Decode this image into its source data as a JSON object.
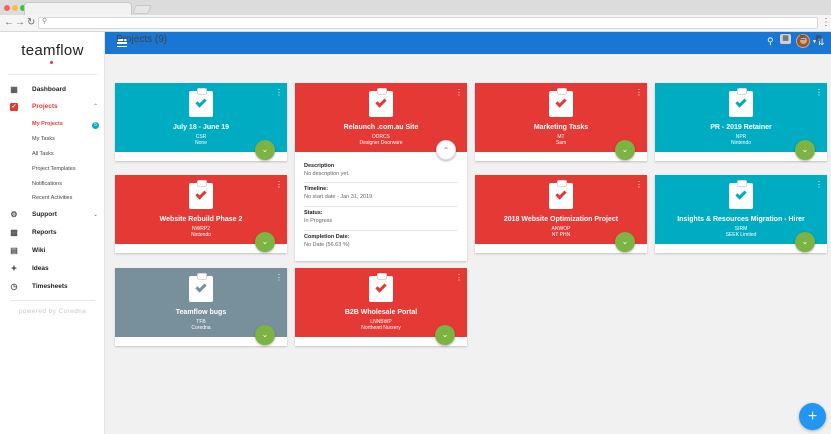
{
  "app": {
    "logo": "teamflow",
    "powered": "powered by Coredna"
  },
  "sidebar": {
    "items": [
      {
        "label": "Dashboard"
      },
      {
        "label": "Projects"
      },
      {
        "label": "Support"
      },
      {
        "label": "Reports"
      },
      {
        "label": "Wiki"
      },
      {
        "label": "Ideas"
      },
      {
        "label": "Timesheets"
      }
    ],
    "projects_sub": [
      "My Projects",
      "My Tasks",
      "All Tasks",
      "Project Templates",
      "Notifications",
      "Recent Activities"
    ],
    "badge": "5"
  },
  "main": {
    "title": "Projects (9)"
  },
  "colors": {
    "cyan": "#00acc1",
    "red": "#e53935",
    "grey": "#78909c",
    "blue": "#1976d2",
    "green": "#7cb342"
  },
  "cards": [
    {
      "title": "July 18 - June 19",
      "code": "CSR",
      "client": "None",
      "color": "cyan"
    },
    {
      "title": "Relaunch .com.au Site",
      "code": "DDRCS",
      "client": "Designer Doorware",
      "color": "red"
    },
    {
      "title": "Marketing Tasks",
      "code": "MT",
      "client": "Sam",
      "color": "red"
    },
    {
      "title": "PR - 2019 Retainer",
      "code": "NPR",
      "client": "Nintendo",
      "color": "cyan"
    },
    {
      "title": "Website Rebuild Phase 2",
      "code": "NWRP2",
      "client": "Nintendo",
      "color": "red"
    },
    {
      "title": "2018 Website Optimization Project",
      "code": "ANWOP",
      "client": "NT PHN",
      "color": "red"
    },
    {
      "title": "Insights & Resources Migration - Hirer",
      "code": "SIRM",
      "client": "SEEK Limited",
      "color": "cyan"
    },
    {
      "title": "Teamflow bugs",
      "code": "TFB",
      "client": "Coredna",
      "color": "grey"
    },
    {
      "title": "B2B Wholesale Portal",
      "code": "LNNBWP",
      "client": "Northead Nursery",
      "color": "red"
    }
  ],
  "details": {
    "description_label": "Description",
    "description": "No description yet.",
    "timeline_label": "Timeline:",
    "timeline": "No start date - Jan 31, 2019",
    "status_label": "Status:",
    "status": "In Progress",
    "completion_label": "Completion Date:",
    "completion": "No Date (56.63 %)"
  }
}
